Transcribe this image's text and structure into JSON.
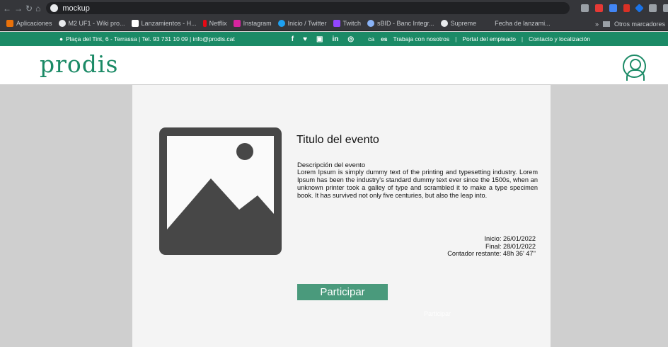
{
  "browser": {
    "tab_title": "mockup",
    "bookmarks": [
      "Aplicaciones",
      "M2 UF1 - Wiki pro...",
      "Lanzamientos - H...",
      "Netflix",
      "Instagram",
      "Inicio / Twitter",
      "Twitch",
      "sBID - Banc Integr...",
      "Supreme",
      "Fecha de lanzami..."
    ],
    "bookmarks_more": "»",
    "other_bookmarks": "Otros marcadores"
  },
  "topbar": {
    "address": "Plaça del Tint, 6 - Terrassa | Tel. 93 731 10 09 | info@prodis.cat",
    "social": [
      "f",
      "♥",
      "▣",
      "in",
      "◎"
    ],
    "lang_ca": "ca",
    "lang_es": "es",
    "links": [
      "Trabaja con nosotros",
      "Portal del empleado",
      "Contacto y localización"
    ]
  },
  "header": {
    "logo": "prodis"
  },
  "event": {
    "title": "Titulo del evento",
    "description_heading": "Descripción del evento",
    "description": "Lorem Ipsum is simply dummy text of the printing and typesetting industry. Lorem Ipsum has been the industry's standard dummy text ever since the 1500s, when an unknown printer took a galley of type and scrambled it to make a type specimen book. It has survived not only five centuries, but also the leap into.",
    "start": "Inicio: 26/01/2022",
    "end": "Final: 28/01/2022",
    "countdown": "Contador restante: 48h 36' 47''",
    "participate_label": "Participar",
    "ghost_text": "Participar"
  },
  "colors": {
    "brand": "#1b8a66",
    "button": "#4a9a7c"
  }
}
